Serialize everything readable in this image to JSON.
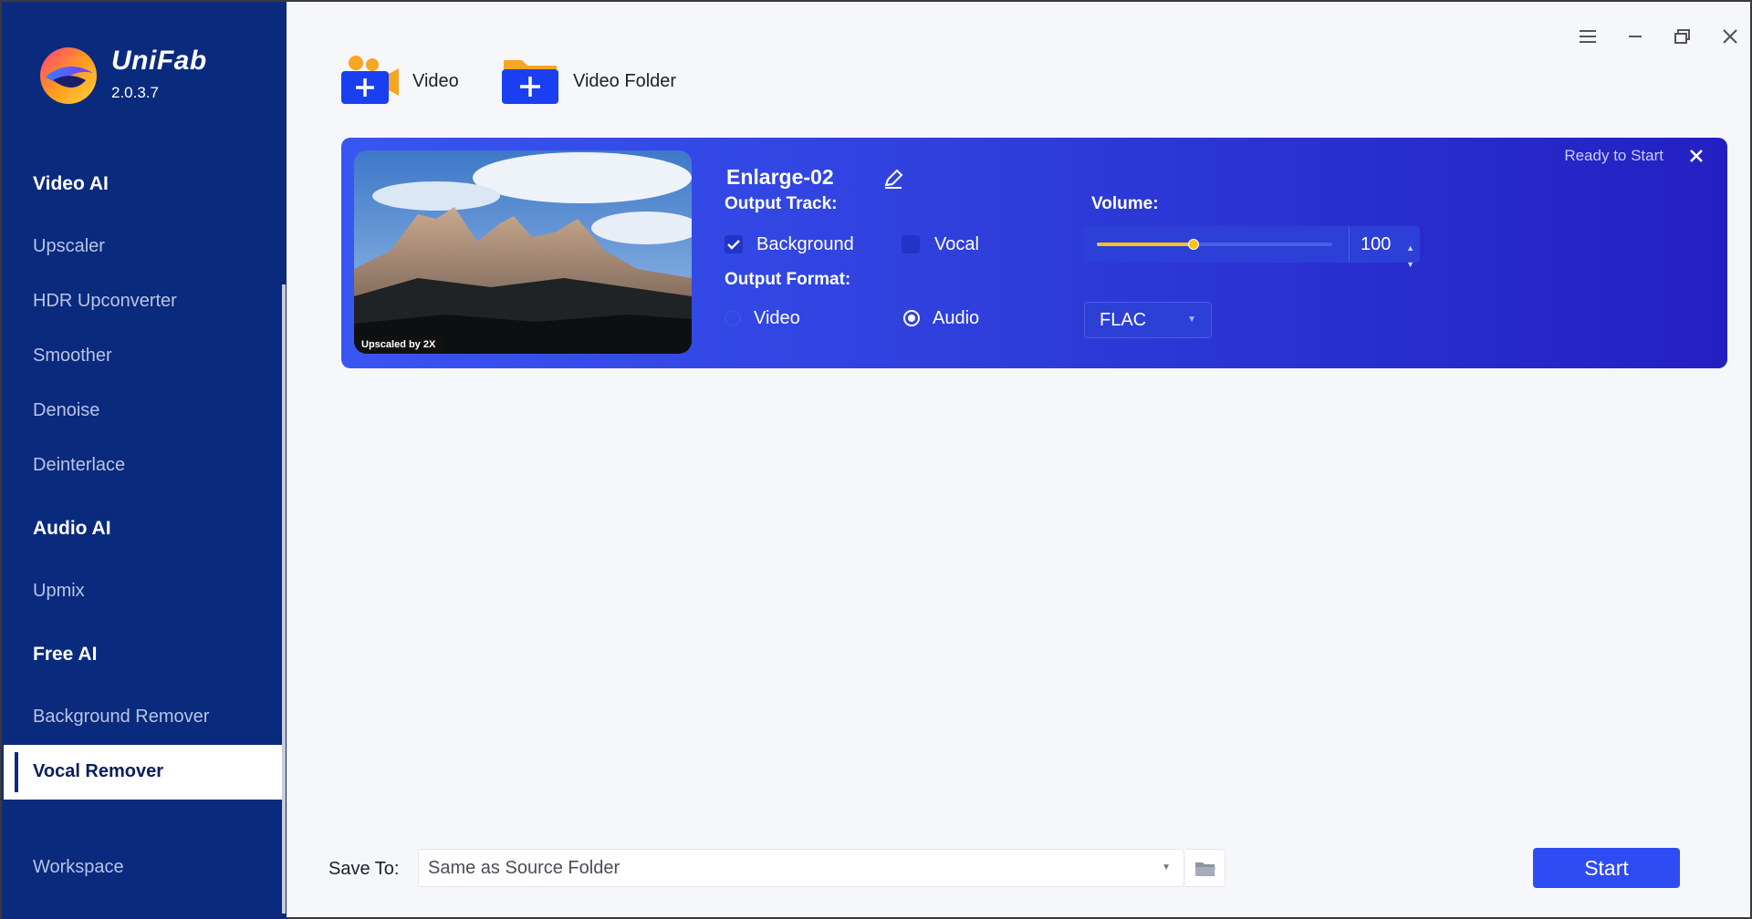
{
  "app": {
    "name": "UniFab",
    "version": "2.0.3.7"
  },
  "sidebar": {
    "sections": [
      {
        "heading": "Video AI",
        "items": [
          "Upscaler",
          "HDR Upconverter",
          "Smoother",
          "Denoise",
          "Deinterlace"
        ]
      },
      {
        "heading": "Audio AI",
        "items": [
          "Upmix"
        ]
      },
      {
        "heading": "Free AI",
        "items": [
          "Background Remover",
          "Vocal Remover"
        ]
      }
    ],
    "active_item": "Vocal Remover",
    "workspace": "Workspace"
  },
  "toolbar": {
    "add_video": "Video",
    "add_folder": "Video Folder"
  },
  "task": {
    "thumbnail_badge": "Upscaled by 2X",
    "title": "Enlarge-02",
    "status": "Ready to Start",
    "output_track_label": "Output Track:",
    "tracks": [
      {
        "label": "Background",
        "checked": true
      },
      {
        "label": "Vocal",
        "checked": false
      }
    ],
    "volume_label": "Volume:",
    "volume_value": "100",
    "volume_percent": 0.41,
    "output_format_label": "Output Format:",
    "formats": [
      {
        "label": "Video",
        "selected": false
      },
      {
        "label": "Audio",
        "selected": true
      }
    ],
    "audio_format": "FLAC"
  },
  "bottom": {
    "save_to_label": "Save To:",
    "save_to_value": "Same as Source Folder",
    "start_label": "Start"
  },
  "colors": {
    "sidebar": "#0a2a7e",
    "card_start": "#3856f2",
    "card_end": "#2320c2",
    "accent_yellow": "#f6c21c",
    "start_button": "#2f4bf3"
  }
}
